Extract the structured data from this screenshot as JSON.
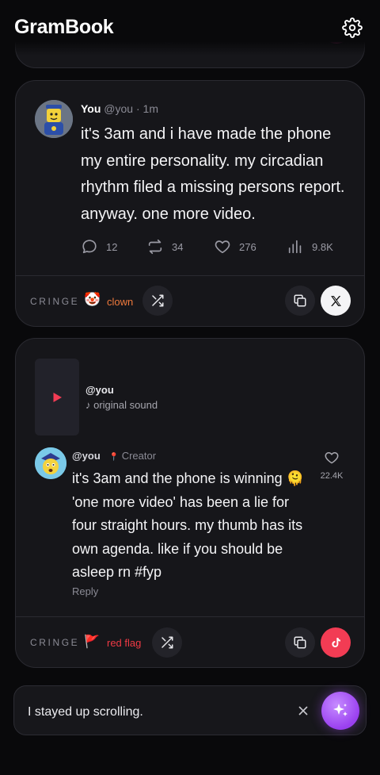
{
  "app": {
    "title": "GramBook"
  },
  "x_post": {
    "display_name": "You",
    "handle": "@you",
    "separator": "·",
    "time": "1m",
    "text": "it's 3am and i have made the phone my entire personality. my circadian rhythm filed a missing persons report. anyway. one more video.",
    "stats": {
      "replies": "12",
      "reposts": "34",
      "likes": "276",
      "views": "9.8K"
    },
    "footer": {
      "label": "CRINGE",
      "rating_emoji": "🤡",
      "rating": "clown",
      "rating_color": "#f07a3c"
    }
  },
  "tiktok_post": {
    "sound_user": "@you",
    "sound_name": "♪ original sound",
    "comment": {
      "user": "@you",
      "badge_icon": "📍",
      "badge": "Creator",
      "text": "it's 3am and the phone is winning 🫠 'one more video' has been a lie for four straight hours. my thumb has its own agenda. like if you should be asleep rn #fyp",
      "reply_label": "Reply",
      "like_count": "22.4K"
    },
    "footer": {
      "label": "CRINGE",
      "rating_emoji": "🚩",
      "rating": "red flag",
      "rating_color": "#ef3a45"
    }
  },
  "input": {
    "value": "I stayed up scrolling."
  },
  "colors": {
    "background": "#09090b",
    "card": "#16161a",
    "tiktok_red": "#f23c54",
    "magic_purple": "#9a40f0"
  }
}
